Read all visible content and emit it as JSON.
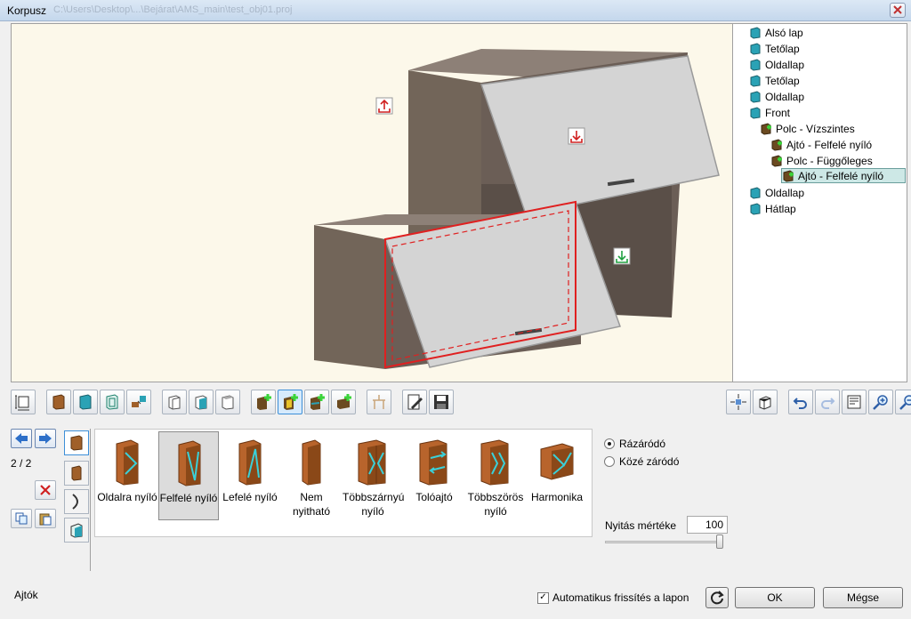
{
  "window": {
    "title": "Korpusz",
    "path": "C:\\Users\\Desktop\\...\\Bejárat\\AMS_main\\test_obj01.proj"
  },
  "tree": {
    "items": [
      {
        "label": "Alsó lap",
        "level": 0,
        "icon": "panel-icon"
      },
      {
        "label": "Tetőlap",
        "level": 0,
        "icon": "panel-icon"
      },
      {
        "label": "Oldallap",
        "level": 0,
        "icon": "panel-icon"
      },
      {
        "label": "Tetőlap",
        "level": 0,
        "icon": "panel-icon"
      },
      {
        "label": "Oldallap",
        "level": 0,
        "icon": "panel-icon"
      },
      {
        "label": "Front",
        "level": 0,
        "icon": "panel-icon"
      },
      {
        "label": "Polc - Vízszintes",
        "level": 1,
        "icon": "shelf-icon"
      },
      {
        "label": "Ajtó - Felfelé nyíló",
        "level": 2,
        "icon": "door-icon"
      },
      {
        "label": "Polc - Függőleges",
        "level": 2,
        "icon": "shelf-icon"
      },
      {
        "label": "Ajtó - Felfelé nyíló",
        "level": 3,
        "icon": "door-icon",
        "selected": true
      },
      {
        "label": "Oldallap",
        "level": 0,
        "icon": "panel-icon"
      },
      {
        "label": "Hátlap",
        "level": 0,
        "icon": "panel-icon"
      }
    ]
  },
  "navigation": {
    "page_indicator": "2 / 2"
  },
  "gallery": {
    "items": [
      {
        "label": "Oldalra nyíló",
        "icon": "side-opening-door-icon"
      },
      {
        "label": "Felfelé nyíló",
        "icon": "upward-opening-door-icon",
        "selected": true
      },
      {
        "label": "Lefelé nyíló",
        "icon": "downward-opening-door-icon"
      },
      {
        "label": "Nem nyitható",
        "icon": "non-opening-door-icon"
      },
      {
        "label": "Többszárnyú nyíló",
        "icon": "multi-leaf-door-icon"
      },
      {
        "label": "Tolóajtó",
        "icon": "sliding-door-icon"
      },
      {
        "label": "Többszörös nyíló",
        "icon": "multiple-opening-door-icon"
      },
      {
        "label": "Harmonika",
        "icon": "accordion-door-icon"
      }
    ]
  },
  "options": {
    "radio_overlay": "Rázáródó",
    "radio_inset": "Közé záródó",
    "opening_label": "Nyitás mértéke",
    "opening_value": "100",
    "opening_fraction": 1.0
  },
  "status": {
    "section": "Ajtók",
    "auto_refresh": "Automatikus frissítés a lapon"
  },
  "buttons": {
    "ok": "OK",
    "cancel": "Mégse"
  },
  "colors": {
    "wood": "#6b5e56",
    "door": "#d4d4d4",
    "selection": "#e02020",
    "viewport_bg": "#fcf8ea",
    "tree_selected": "#cde8e6"
  }
}
